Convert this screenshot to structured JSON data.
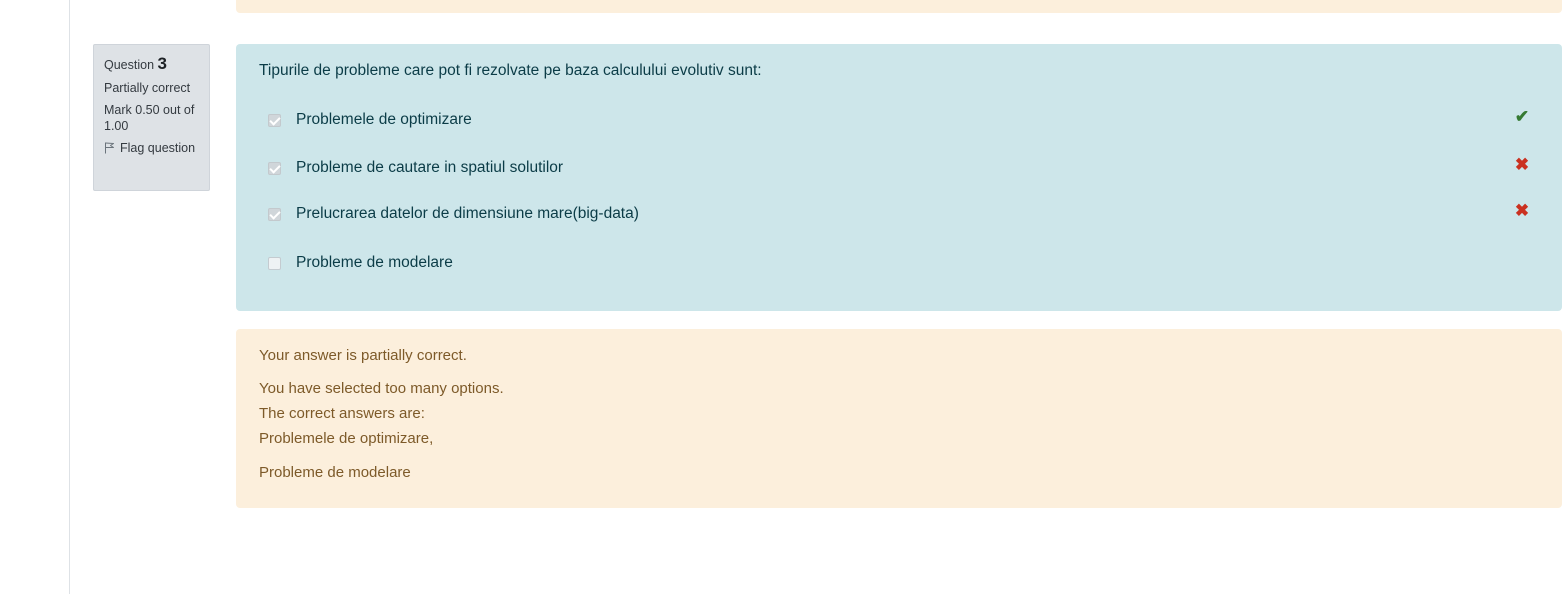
{
  "question": {
    "label": "Question",
    "number": "3",
    "state": "Partially correct",
    "mark": "Mark 0.50 out of 1.00",
    "flag_label": "Flag question",
    "text": "Tipurile de probleme care pot fi rezolvate pe baza calculului evolutiv sunt:"
  },
  "answers": [
    {
      "label": "Problemele de optimizare",
      "checked": true,
      "result": "correct",
      "icon": "check-icon"
    },
    {
      "label": "Probleme de cautare in spatiul solutilor",
      "checked": true,
      "result": "incorrect",
      "icon": "cross-icon"
    },
    {
      "label": "Prelucrarea datelor de dimensiune mare(big-data)",
      "checked": true,
      "result": "incorrect",
      "icon": "cross-icon"
    },
    {
      "label": "Probleme de modelare",
      "checked": false,
      "result": "",
      "icon": ""
    }
  ],
  "feedback": {
    "summary": "Your answer is partially correct.",
    "too_many": "You have selected too many options.",
    "correct_intro": "The correct answers are:",
    "correct_1": "Problemele de optimizare,",
    "correct_2": "Probleme de modelare"
  },
  "colors": {
    "formulation_bg": "#cde6ea",
    "feedback_bg": "#fcefdc",
    "correct": "#357a32",
    "incorrect": "#ca3120"
  }
}
